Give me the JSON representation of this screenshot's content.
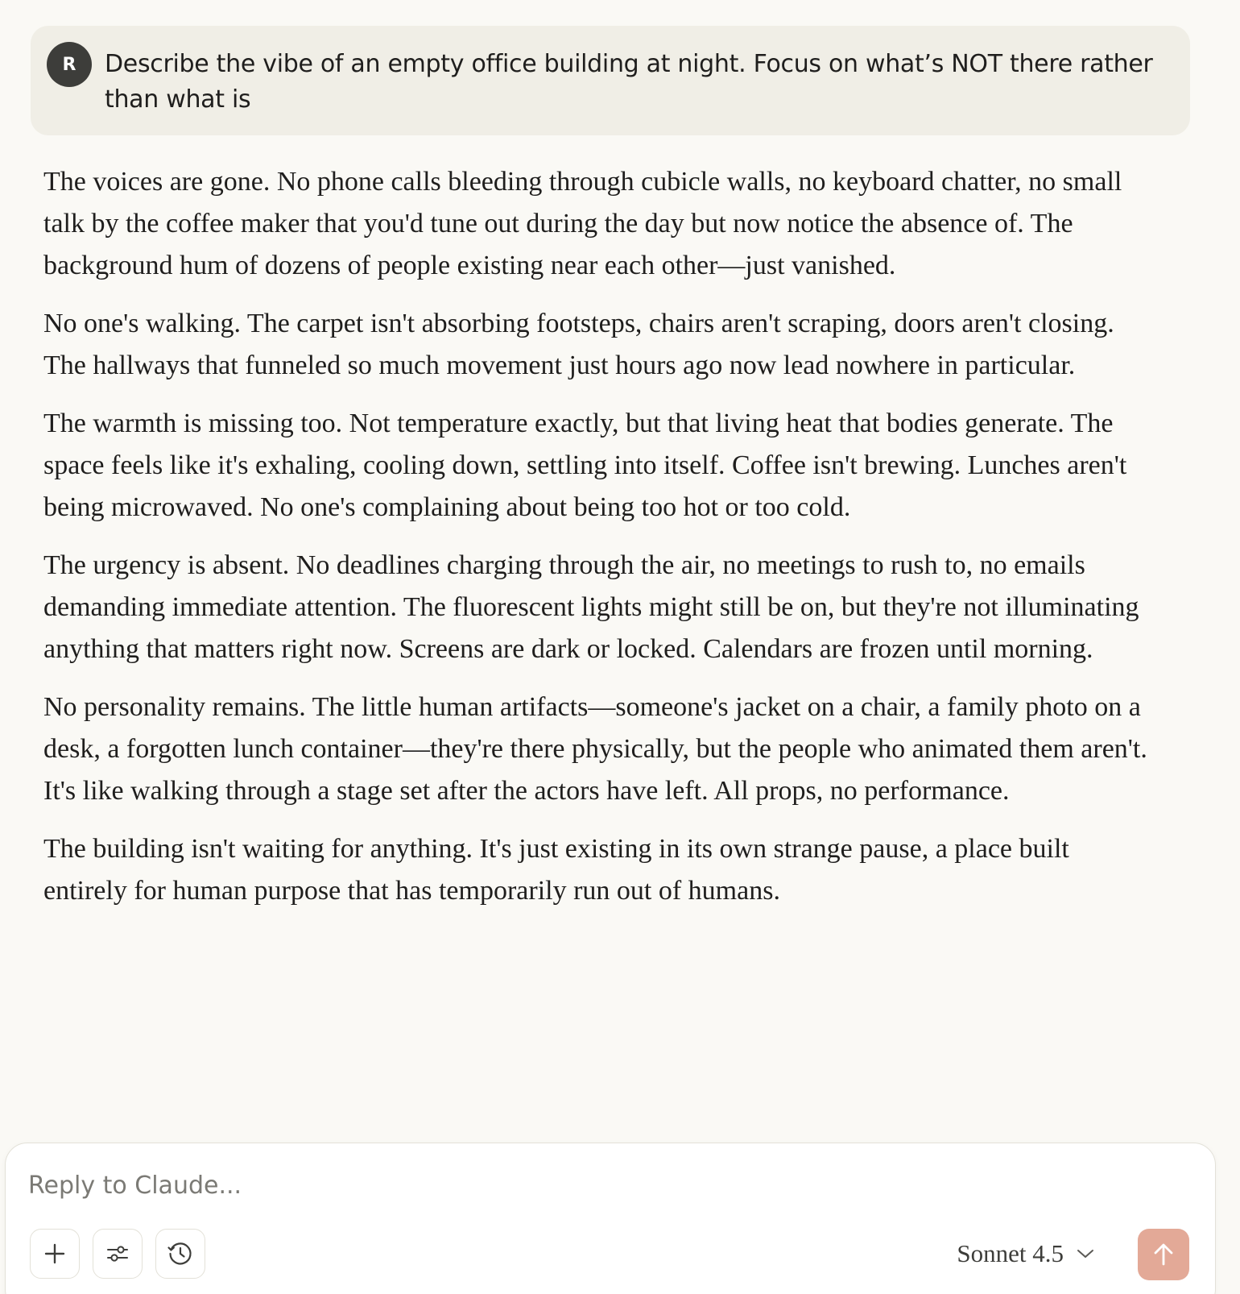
{
  "user_message": {
    "avatar_initial": "R",
    "text": "Describe the vibe of an empty office building at night. Focus on what’s NOT there rather than what is"
  },
  "response": {
    "paragraphs": [
      "The voices are gone. No phone calls bleeding through cubicle walls, no keyboard chatter, no small talk by the coffee maker that you'd tune out during the day but now notice the absence of. The background hum of dozens of people existing near each other—just vanished.",
      "No one's walking. The carpet isn't absorbing footsteps, chairs aren't scraping, doors aren't closing. The hallways that funneled so much movement just hours ago now lead nowhere in particular.",
      "The warmth is missing too. Not temperature exactly, but that living heat that bodies generate. The space feels like it's exhaling, cooling down, settling into itself. Coffee isn't brewing. Lunches aren't being microwaved. No one's complaining about being too hot or too cold.",
      "The urgency is absent. No deadlines charging through the air, no meetings to rush to, no emails demanding immediate attention. The fluorescent lights might still be on, but they're not illuminating anything that matters right now. Screens are dark or locked. Calendars are frozen until morning.",
      "No personality remains. The little human artifacts—someone's jacket on a chair, a family photo on a desk, a forgotten lunch container—they're there physically, but the people who animated them aren't. It's like walking through a stage set after the actors have left. All props, no performance.",
      "The building isn't waiting for anything. It's just existing in its own strange pause, a place built entirely for human purpose that has temporarily run out of humans."
    ]
  },
  "composer": {
    "placeholder": "Reply to Claude...",
    "value": "",
    "model_name": "Sonnet 4.5",
    "icons": {
      "add": "plus-icon",
      "tools": "sliders-icon",
      "history": "clock-icon",
      "model_dropdown": "chevron-down-icon",
      "send": "arrow-up-icon"
    }
  },
  "colors": {
    "background": "#faf9f5",
    "user_bubble": "#f0eee6",
    "avatar": "#3d3d3a",
    "send_button": "#e3a997",
    "text": "#1f1e1d"
  }
}
